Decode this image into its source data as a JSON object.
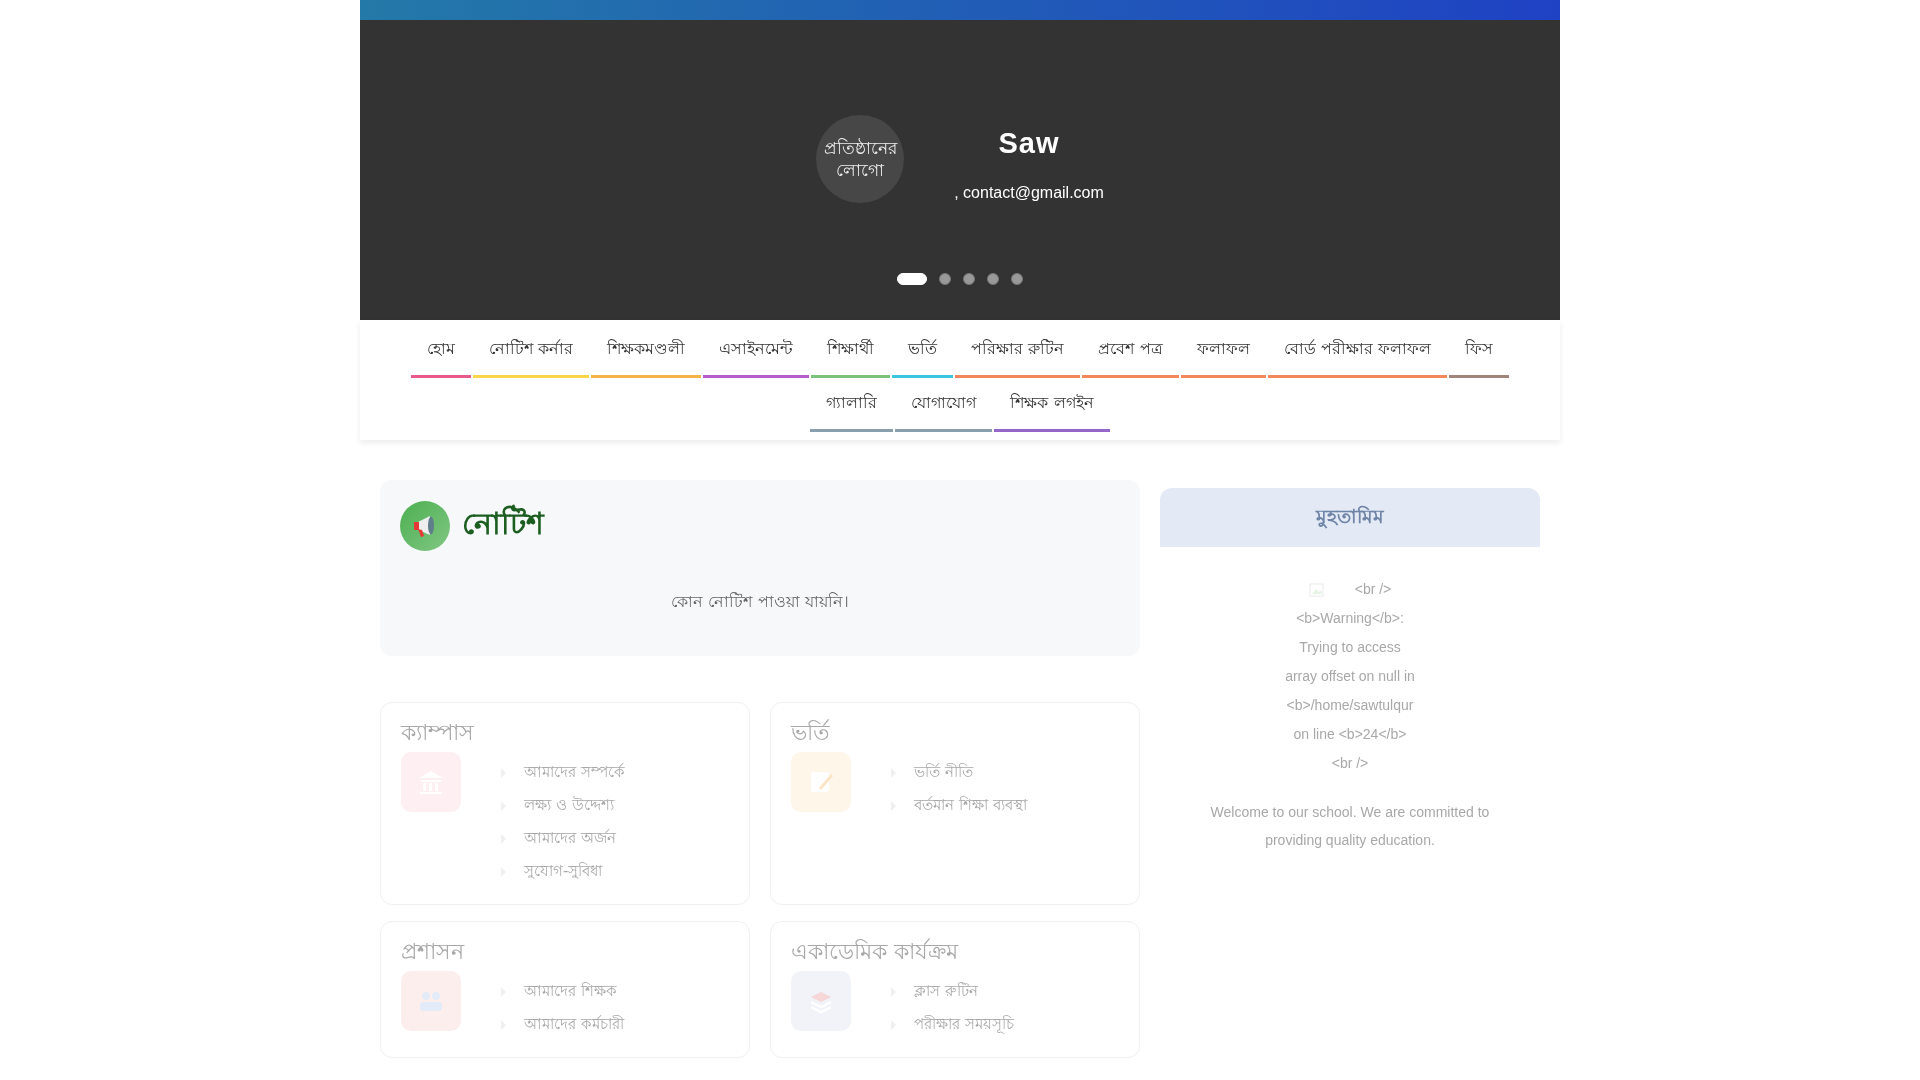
{
  "header": {
    "logo_text": "প্রতিষ্ঠানের লোগো",
    "title": "Saw",
    "contact": ", contact@gmail.com",
    "slides": [
      {
        "selected": true
      },
      {
        "selected": false
      },
      {
        "selected": false
      },
      {
        "selected": false
      },
      {
        "selected": false
      }
    ]
  },
  "nav": [
    {
      "label": "হোম",
      "color": "#e95a8a"
    },
    {
      "label": "নোটিশ কর্নার",
      "color": "#f9d549"
    },
    {
      "label": "শিক্ষকমণ্ডলী",
      "color": "#f7b347"
    },
    {
      "label": "এসাইনমেন্ট",
      "color": "#b35ec9"
    },
    {
      "label": "শিক্ষার্থী",
      "color": "#7cc17c"
    },
    {
      "label": "ভর্তি",
      "color": "#3cc6db"
    },
    {
      "label": "পরিক্ষার রুটিন",
      "color": "#f5875e"
    },
    {
      "label": "প্রবেশ পত্র",
      "color": "#f5875e"
    },
    {
      "label": "ফলাফল",
      "color": "#f5875e"
    },
    {
      "label": "বোর্ড পরীক্ষার ফলাফল",
      "color": "#f5875e"
    },
    {
      "label": "ফিস",
      "color": "#a0857a"
    },
    {
      "label": "গ্যালারি",
      "color": "#8a9fae"
    },
    {
      "label": "যোগাযোগ",
      "color": "#8a9fae"
    },
    {
      "label": "শিক্ষক লগইন",
      "color": "#9466c9"
    }
  ],
  "notice": {
    "title": "নোটিশ",
    "empty_message": "কোন নোটিশ পাওয়া যায়নি।"
  },
  "sections": [
    {
      "kind": "building",
      "title": "ক্যাম্পাস",
      "items": [
        "আমাদের সম্পর্কে",
        "লক্ষ্য ও উদ্দেশ্য",
        "আমাদের অর্জন",
        "সুযোগ-সুবিধা"
      ]
    },
    {
      "kind": "edit",
      "title": "ভর্তি",
      "items": [
        "ভর্তি নীতি",
        "বর্তমান শিক্ষা ব্যবস্থা"
      ]
    },
    {
      "kind": "people",
      "title": "প্রশাসন",
      "items": [
        "আমাদের শিক্ষক",
        "আমাদের কর্মচারী"
      ]
    },
    {
      "kind": "books",
      "title": "একাডেমিক কার্যক্রম",
      "items": [
        "ক্লাস রুটিন",
        "পরীক্ষার সময়সূচি"
      ]
    }
  ],
  "principal": {
    "title": "মুহতামিম",
    "error_lines": [
      "<br />",
      "<b>Warning</b>:",
      "Trying to access",
      "array offset on null in",
      "<b>/home/sawtulqur",
      "on line <b>24</b>",
      "<br />"
    ],
    "message": "Welcome to our school. We are committed to providing quality education."
  }
}
